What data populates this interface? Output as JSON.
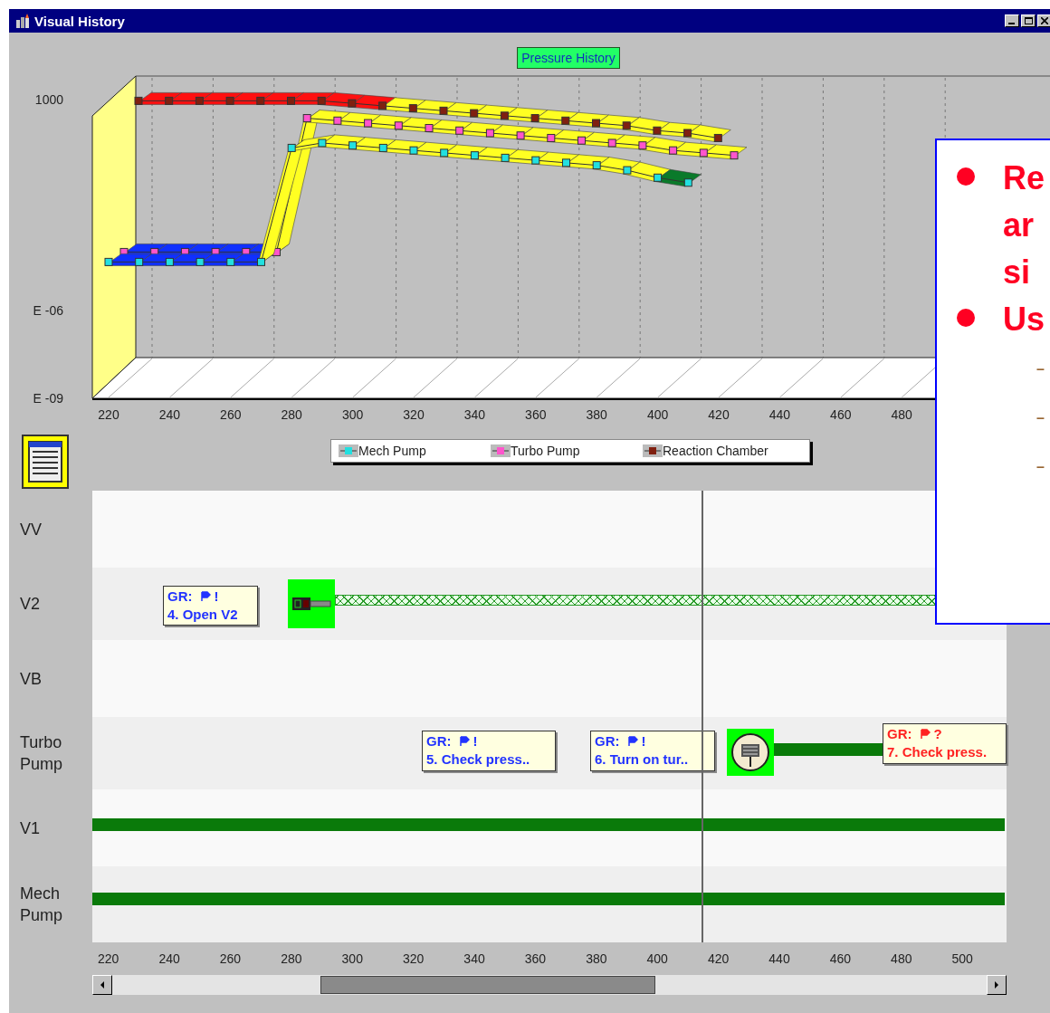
{
  "window": {
    "title": "Visual History"
  },
  "chart": {
    "title": "Pressure History",
    "y_labels": [
      "1000",
      "E -06",
      "E -09"
    ],
    "x_labels": [
      "220",
      "240",
      "260",
      "280",
      "300",
      "320",
      "340",
      "360",
      "380",
      "400",
      "420",
      "440",
      "460",
      "480"
    ],
    "legend": [
      {
        "label": "Mech Pump",
        "color": "#22e0e0"
      },
      {
        "label": "Turbo Pump",
        "color": "#ff55cc"
      },
      {
        "label": "Reaction Chamber",
        "color": "#802010"
      }
    ]
  },
  "timeline": {
    "rows": [
      {
        "label": "VV"
      },
      {
        "label": "V2",
        "items": [
          {
            "kind": "event",
            "tag": "GR:",
            "mark": "!",
            "text": "4. Open V2",
            "color": "#2233ff"
          },
          {
            "kind": "valve"
          },
          {
            "kind": "hatched-bar"
          }
        ]
      },
      {
        "label": "VB"
      },
      {
        "label": "Turbo Pump",
        "items": [
          {
            "kind": "event",
            "tag": "GR:",
            "mark": "!",
            "text": "5. Check press..",
            "color": "#2233ff"
          },
          {
            "kind": "event",
            "tag": "GR:",
            "mark": "!",
            "text": "6. Turn on tur..",
            "color": "#2233ff"
          },
          {
            "kind": "pump"
          },
          {
            "kind": "bar"
          },
          {
            "kind": "event",
            "tag": "GR:",
            "mark": "?",
            "text": "7. Check press.",
            "color": "#ff2222"
          }
        ]
      },
      {
        "label": "V1",
        "items": [
          {
            "kind": "bar"
          }
        ]
      },
      {
        "label": "Mech Pump",
        "items": [
          {
            "kind": "bar"
          }
        ]
      }
    ],
    "axis_ticks": [
      "220",
      "240",
      "260",
      "280",
      "300",
      "320",
      "340",
      "360",
      "380",
      "400",
      "420",
      "440",
      "460",
      "480",
      "500"
    ]
  },
  "overlay": {
    "bullets": [
      {
        "lines": [
          "Re",
          "ar",
          "si"
        ]
      },
      {
        "lines": [
          "Us"
        ],
        "sub_items": [
          "–",
          "–",
          "–"
        ]
      }
    ]
  }
}
